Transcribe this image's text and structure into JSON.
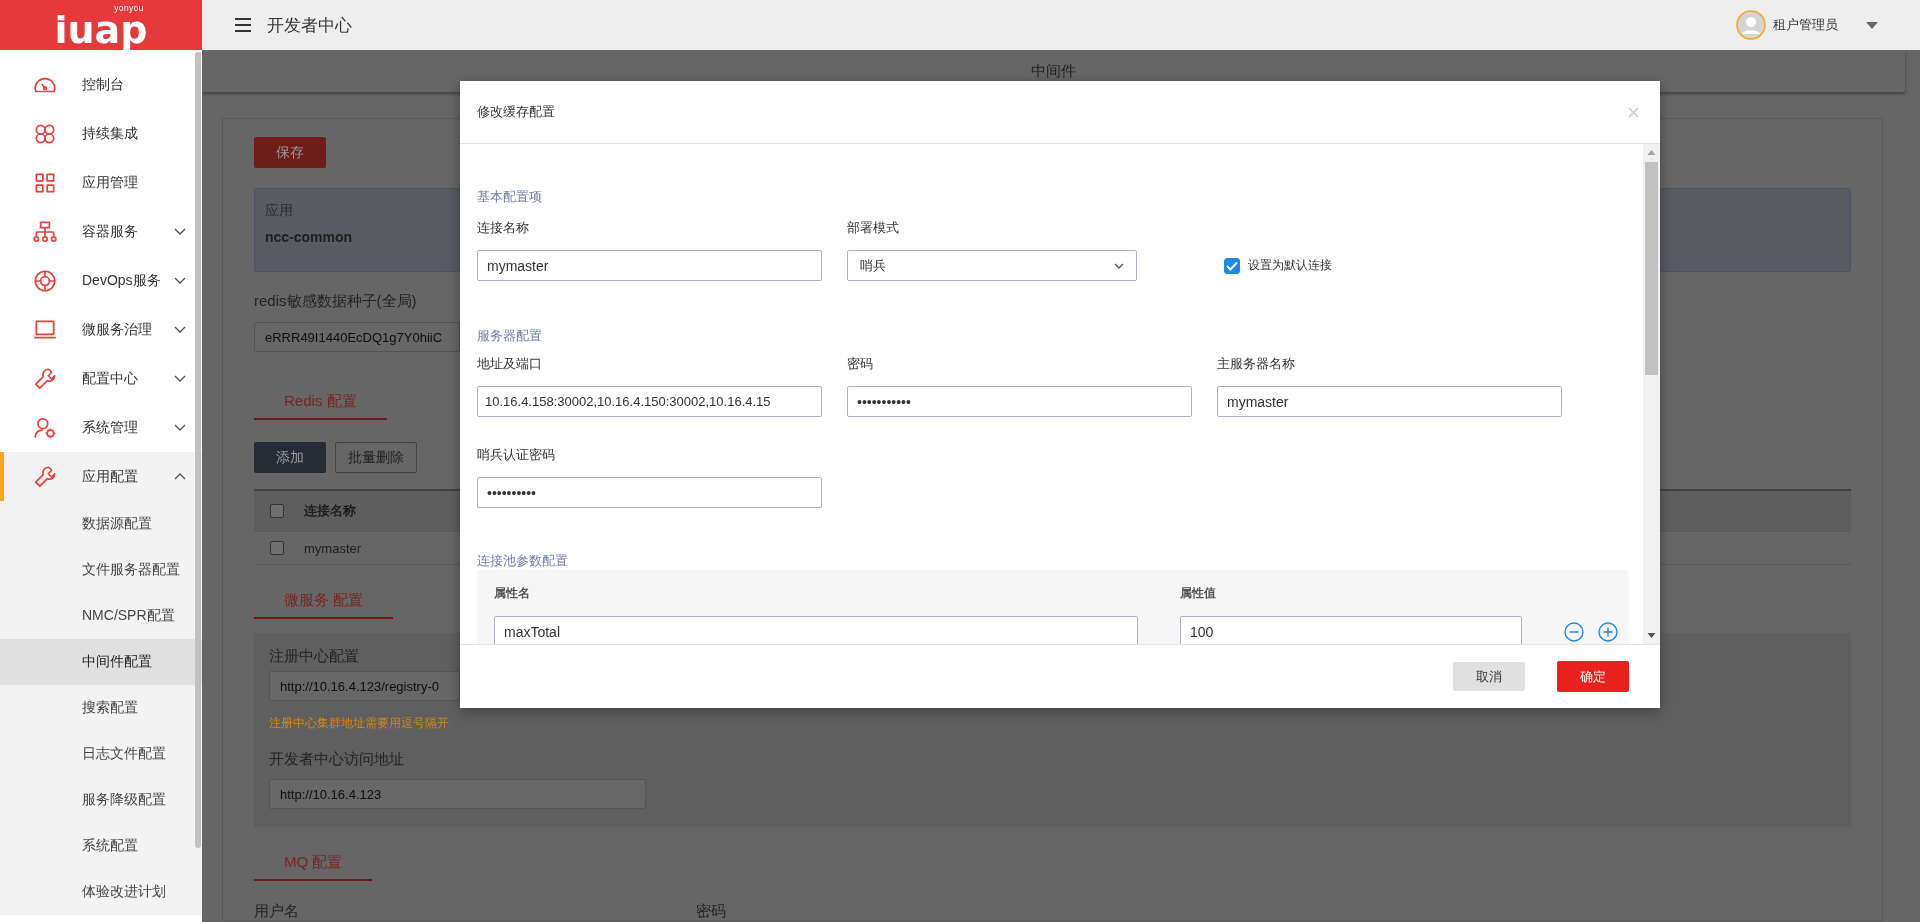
{
  "header": {
    "logo": {
      "text": "iuap",
      "subtext": "yonyou"
    },
    "title": "开发者中心",
    "user": "租户管理员"
  },
  "sidebar": {
    "items": [
      {
        "label": "控制台",
        "active": false
      },
      {
        "label": "持续集成",
        "active": false
      },
      {
        "label": "应用管理",
        "active": false
      },
      {
        "label": "容器服务",
        "active": false,
        "expanded": false
      },
      {
        "label": "DevOps服务",
        "active": false,
        "expanded": false
      },
      {
        "label": "微服务治理",
        "active": false,
        "expanded": false
      },
      {
        "label": "配置中心",
        "active": false,
        "expanded": false
      },
      {
        "label": "系统管理",
        "active": false,
        "expanded": false
      },
      {
        "label": "应用配置",
        "active": true,
        "expanded": true,
        "children": [
          {
            "label": "数据源配置",
            "selected": false
          },
          {
            "label": "文件服务器配置",
            "selected": false
          },
          {
            "label": "NMC/SPR配置",
            "selected": false
          },
          {
            "label": "中间件配置",
            "selected": true
          },
          {
            "label": "搜索配置",
            "selected": false
          },
          {
            "label": "日志文件配置",
            "selected": false
          },
          {
            "label": "服务降级配置",
            "selected": false
          },
          {
            "label": "系统配置",
            "selected": false
          },
          {
            "label": "体验改进计划",
            "selected": false
          }
        ]
      }
    ]
  },
  "page": {
    "title": "中间件",
    "save_button": "保存",
    "app": {
      "label": "应用",
      "value": "ncc-common"
    },
    "seed": {
      "label": "redis敏感数据种子(全局)",
      "value": "eRRR49I1440EcDQ1g7Y0hiiC"
    },
    "redis": {
      "tab": "Redis 配置",
      "buttons": [
        "添加",
        "批量删除"
      ],
      "table": {
        "header_checked": false,
        "columns": [
          "连接名称"
        ],
        "rows": [
          {
            "checked": false,
            "cells": [
              "mymaster"
            ]
          }
        ]
      }
    },
    "microservice": {
      "tab": "微服务 配置",
      "registry": {
        "label": "注册中心配置",
        "value": "http://10.16.4.123/registry-0",
        "hint": "注册中心集群地址需要用逗号隔开"
      },
      "dev_center": {
        "label": "开发者中心访问地址",
        "value": "http://10.16.4.123"
      }
    },
    "mq": {
      "tab": "MQ 配置",
      "fields": [
        "用户名",
        "密码"
      ]
    }
  },
  "modal": {
    "title": "修改缓存配置",
    "basic": {
      "title": "基本配置项",
      "connection_name": {
        "label": "连接名称",
        "value": "mymaster"
      },
      "deploy_mode": {
        "label": "部署模式",
        "value": "哨兵"
      },
      "default_connection": {
        "label": "设置为默认连接",
        "checked": true
      }
    },
    "server": {
      "title": "服务器配置",
      "address": {
        "label": "地址及端口",
        "value": "10.16.4.158:30002,10.16.4.150:30002,10.16.4.15"
      },
      "password": {
        "label": "密码",
        "value": "•••••••••••"
      },
      "master_name": {
        "label": "主服务器名称",
        "value": "mymaster"
      },
      "sentinel_password": {
        "label": "哨兵认证密码",
        "value": "••••••••••"
      }
    },
    "pool": {
      "title": "连接池参数配置",
      "columns": [
        "属性名",
        "属性值"
      ],
      "rows": [
        {
          "name": "maxTotal",
          "value": "100"
        }
      ]
    },
    "buttons": [
      {
        "label": "取消",
        "kind": "secondary"
      },
      {
        "label": "确定",
        "kind": "primary"
      }
    ]
  }
}
